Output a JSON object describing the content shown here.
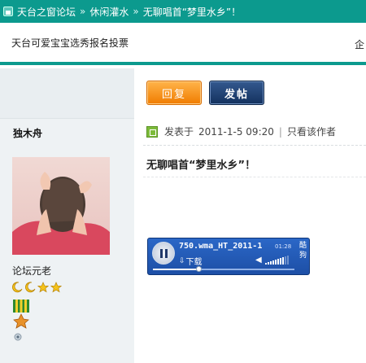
{
  "breadcrumb": {
    "items": [
      "天台之窗论坛",
      "休闲灌水",
      "无聊唱首“梦里水乡”！"
    ],
    "separator": "»"
  },
  "tabs": {
    "left": "天台可爱宝宝选秀报名投票",
    "right": "企"
  },
  "toolbar": {
    "reply_label": "回复",
    "post_label": "发帖"
  },
  "author": {
    "name": "独木舟",
    "rank": "论坛元老",
    "stars": [
      "moon-icon",
      "moon-icon",
      "star-icon",
      "star-icon"
    ]
  },
  "post": {
    "posted_prefix": "发表于",
    "date": "2011-1-5 09:20",
    "separator": "|",
    "only_author": "只看该作者",
    "title": "无聊唱首“梦里水乡”！"
  },
  "player": {
    "track": "750.wma_HT_2011-1",
    "time": "01:28",
    "download_label": "下载",
    "brand": "酷狗",
    "progress": 0.33,
    "volume_level": 0.8
  },
  "colors": {
    "header": "#0c9a8e",
    "reply_button": "#f08400",
    "post_button": "#1b3a6b",
    "player": "#2459b8"
  }
}
